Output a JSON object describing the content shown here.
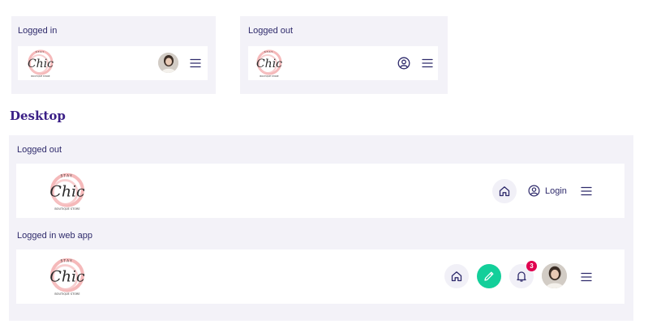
{
  "mobile": {
    "logged_in_label": "Logged in",
    "logged_out_label": "Logged out"
  },
  "section_title": "Desktop",
  "desktop": {
    "logged_out_label": "Logged out",
    "logged_in_label": "Logged in web app",
    "login_label": "Login",
    "notification_count": "3"
  },
  "logo": {
    "word": "Chic",
    "top_text": "S T A Y",
    "tagline": "BOUTIQUE STORE"
  },
  "colors": {
    "panel_bg": "#f3f2f8",
    "bar_bg": "#ffffff",
    "text": "#2e2a6b",
    "heading": "#3a1f86",
    "accent_green": "#13cf9a",
    "badge_red": "#e0004f",
    "logo_pink": "#f2a7a9"
  },
  "icons": [
    "user-avatar",
    "menu-icon",
    "user-circle-icon",
    "home-icon",
    "pencil-icon",
    "bell-icon"
  ]
}
